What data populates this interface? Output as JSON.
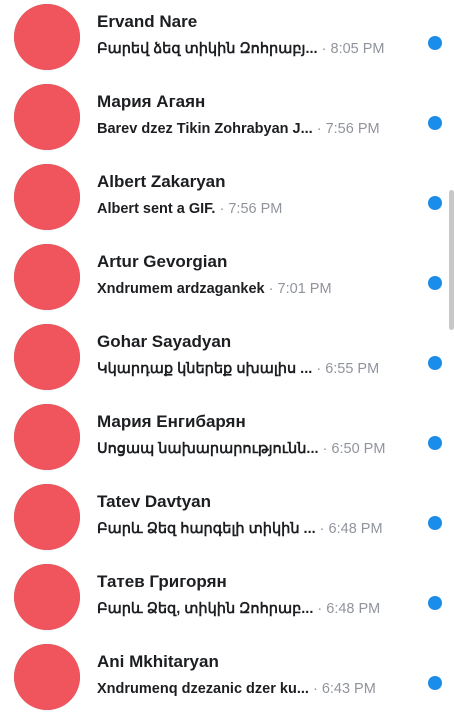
{
  "conversations": [
    {
      "name": "Ervand Nare",
      "preview": "Բարեվ ձեզ տիկին Զոհրաբյ...",
      "time": "8:05 PM",
      "unread": true
    },
    {
      "name": "Мария Агаян",
      "preview": "Barev dzez Tikin Zohrabyan J...",
      "time": "7:56 PM",
      "unread": true
    },
    {
      "name": "Albert Zakaryan",
      "preview": "Albert sent a GIF.",
      "time": "7:56 PM",
      "unread": true
    },
    {
      "name": "Artur Gevorgian",
      "preview": "Xndrumem ardzagankek",
      "time": "7:01 PM",
      "unread": true
    },
    {
      "name": "Gohar Sayadyan",
      "preview": "Կկարդաք կներեք սխալիս ...",
      "time": "6:55 PM",
      "unread": true
    },
    {
      "name": "Мария Енгибарян",
      "preview": "Սոցապ նախարարությունն...",
      "time": "6:50 PM",
      "unread": true
    },
    {
      "name": "Tatev Davtyan",
      "preview": "Բարև Ձեզ հարգելի տիկին ...",
      "time": "6:48 PM",
      "unread": true
    },
    {
      "name": "Татев Григорян",
      "preview": "Բարև Ձեզ,  տիկին Զոհրաբ...",
      "time": "6:48 PM",
      "unread": true
    },
    {
      "name": "Ani Mkhitaryan",
      "preview": "Xndrumenq dzezanic dzer ku...",
      "time": "6:43 PM",
      "unread": true
    }
  ],
  "separator": "·",
  "colors": {
    "unread_dot": "#1a8cea",
    "avatar_redaction": "#f0545c",
    "time": "#90949c"
  }
}
